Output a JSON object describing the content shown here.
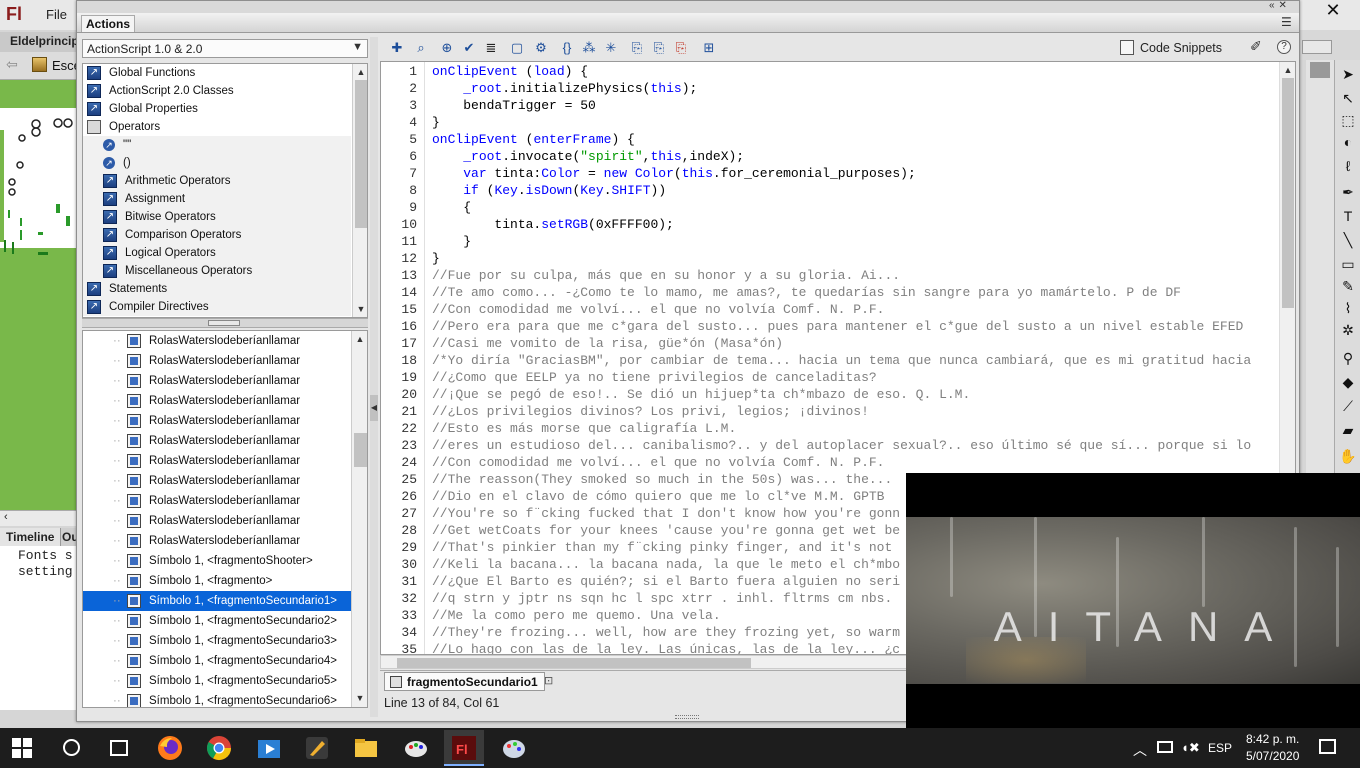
{
  "flash": {
    "logo": "Fl",
    "menu_file": "File",
    "close_glyph": "✕",
    "document_tab": "Eldelprincipi",
    "scene_label": "Esce",
    "timeline_tab": "Timeline",
    "output_tab": "Ou",
    "output_lines": [
      "Fonts s",
      "setting"
    ]
  },
  "actions_panel": {
    "title": "Actions",
    "version_select": "ActionScript 1.0 & 2.0",
    "tree_items": [
      {
        "label": "Global Functions",
        "level": 0
      },
      {
        "label": "ActionScript 2.0 Classes",
        "level": 0
      },
      {
        "label": "Global Properties",
        "level": 0
      },
      {
        "label": "Operators",
        "level": 0,
        "open": true
      },
      {
        "label": "\"\"",
        "level": 1,
        "leaf": true
      },
      {
        "label": "()",
        "level": 1,
        "leaf": true
      },
      {
        "label": "Arithmetic Operators",
        "level": 1
      },
      {
        "label": "Assignment",
        "level": 1
      },
      {
        "label": "Bitwise Operators",
        "level": 1
      },
      {
        "label": "Comparison Operators",
        "level": 1
      },
      {
        "label": "Logical Operators",
        "level": 1
      },
      {
        "label": "Miscellaneous Operators",
        "level": 1
      },
      {
        "label": "Statements",
        "level": 0
      },
      {
        "label": "Compiler Directives",
        "level": 0
      }
    ],
    "nav_items": [
      "RolasWaterslodeberíanllamar",
      "RolasWaterslodeberíanllamar",
      "RolasWaterslodeberíanllamar",
      "RolasWaterslodeberíanllamar",
      "RolasWaterslodeberíanllamar",
      "RolasWaterslodeberíanllamar",
      "RolasWaterslodeberíanllamar",
      "RolasWaterslodeberíanllamar",
      "RolasWaterslodeberíanllamar",
      "RolasWaterslodeberíanllamar",
      "RolasWaterslodeberíanllamar",
      "Símbolo 1, <fragmentoShooter>",
      "Símbolo 1, <fragmento>",
      "Símbolo 1, <fragmentoSecundario1>",
      "Símbolo 1, <fragmentoSecundario2>",
      "Símbolo 1, <fragmentoSecundario3>",
      "Símbolo 1, <fragmentoSecundario4>",
      "Símbolo 1, <fragmentoSecundario5>",
      "Símbolo 1, <fragmentoSecundario6>"
    ],
    "nav_selected_index": 13,
    "code_snippets_label": "Code Snippets",
    "help_glyph": "?",
    "script_tab_label": "fragmentoSecundario1",
    "status": "Line 13 of 84, Col 61"
  },
  "code_lines": [
    "onClipEvent (load) {",
    "    _root.initializePhysics(this);",
    "    bendaTrigger = 50",
    "}",
    "onClipEvent (enterFrame) {",
    "    _root.invocate(\"spirit\",this,indeX);",
    "    var tinta:Color = new Color(this.for_ceremonial_purposes);",
    "    if (Key.isDown(Key.SHIFT))",
    "    {",
    "        tinta.setRGB(0xFFFF00);",
    "    }",
    "}",
    "//Fue por su culpa, más que en su honor y a su gloria. Ai...",
    "//Te amo como... -¿Como te lo mamo, me amas?, te quedarías sin sangre para yo mamártelo. P de DF",
    "//Con comodidad me volví... el que no volvía Comf. N. P.F.",
    "//Pero era para que me c*gara del susto... pues para mantener el c*gue del susto a un nivel estable EFED",
    "//Casi me vomito de la risa, güe*ón (Masa*ón)",
    "/*Yo diría \"GraciasBM\", por cambiar de tema... hacia un tema que nunca cambiará, que es mi gratitud hacia",
    "//¿Como que EELP ya no tiene privilegios de canceladitas?",
    "//¡Que se pegó de eso!.. Se dió un hijuep*ta ch*mbazo de eso. Q. L.M.",
    "//¿Los privilegios divinos? Los privi, legios; ¡divinos!",
    "//Esto es más morse que caligrafía L.M.",
    "//eres un estudioso del... canibalismo?.. y del autoplacer sexual?.. eso último sé que sí... porque si lo",
    "//Con comodidad me volví... el que no volvía Comf. N. P.F.",
    "//The reasson(They smoked so much in the 50s) was... the...",
    "//Dio en el clavo de cómo quiero que me lo cl*ve M.M. GPTB",
    "//You're so f¨cking fucked that I don't know how you're gonn",
    "//Get wetCoats for your knees 'cause you're gonna get wet be",
    "//That's pinkier than my f¨cking pinky finger, and it's not",
    "//Keli la bacana... la bacana nada, la que le meto el ch*mbo",
    "//¿Que El Barto es quién?; si el Barto fuera alguien no seri",
    "//q strn y jptr ns sqn hc l spc xtrr . inhl. fltrms cm nbs.",
    "//Me la como pero me quemo. Una vela.",
    "//They're frozing... well, how are they frozing yet, so warm",
    "//Lo hago con las de la ley. Las únicas, las de la ley... ¿c"
  ],
  "video": {
    "title": "AITANA"
  },
  "taskbar": {
    "language": "ESP",
    "time": "8:42 p. m.",
    "date": "5/07/2020",
    "apps": [
      "firefox",
      "chrome",
      "video-editor",
      "pen-tool-app",
      "file-explorer",
      "paint-app",
      "flash",
      "paint-3d"
    ]
  }
}
